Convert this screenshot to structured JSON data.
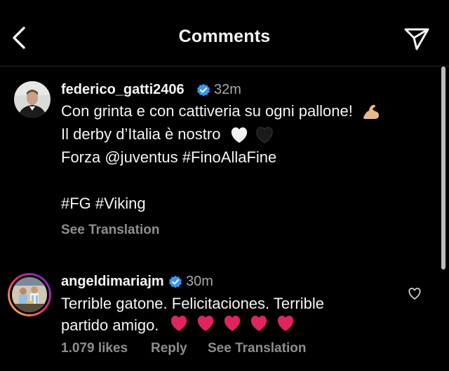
{
  "header": {
    "title": "Comments",
    "back_icon": "chevron-left-icon",
    "share_icon": "send-icon"
  },
  "caption": {
    "username": "federico_gatti2406",
    "verified": true,
    "time": "32m",
    "lines": [
      "Con grinta e con cattiveria su ogni pallone!",
      "Il derby d’Italia è nostro",
      "Forza @juventus #FinoAllaFine",
      "#FG #Viking"
    ],
    "line_emojis": [
      "flexed-biceps",
      "white-heart black-heart"
    ],
    "see_translation": "See Translation"
  },
  "comments": [
    {
      "username": "angeldimariajm",
      "verified": true,
      "time": "30m",
      "text_line1": "Terrible gatone. Felicitaciones. Terrible",
      "text_line2": "partido amigo.",
      "emojis": "red-heart x5",
      "likes": "1.079 likes",
      "reply": "Reply",
      "see_translation": "See Translation"
    }
  ],
  "colors": {
    "background": "#000000",
    "text": "#f5f5f5",
    "secondary_text": "#8e8e8e",
    "verified_badge": "#3897f0",
    "heart": "#e0245e"
  }
}
